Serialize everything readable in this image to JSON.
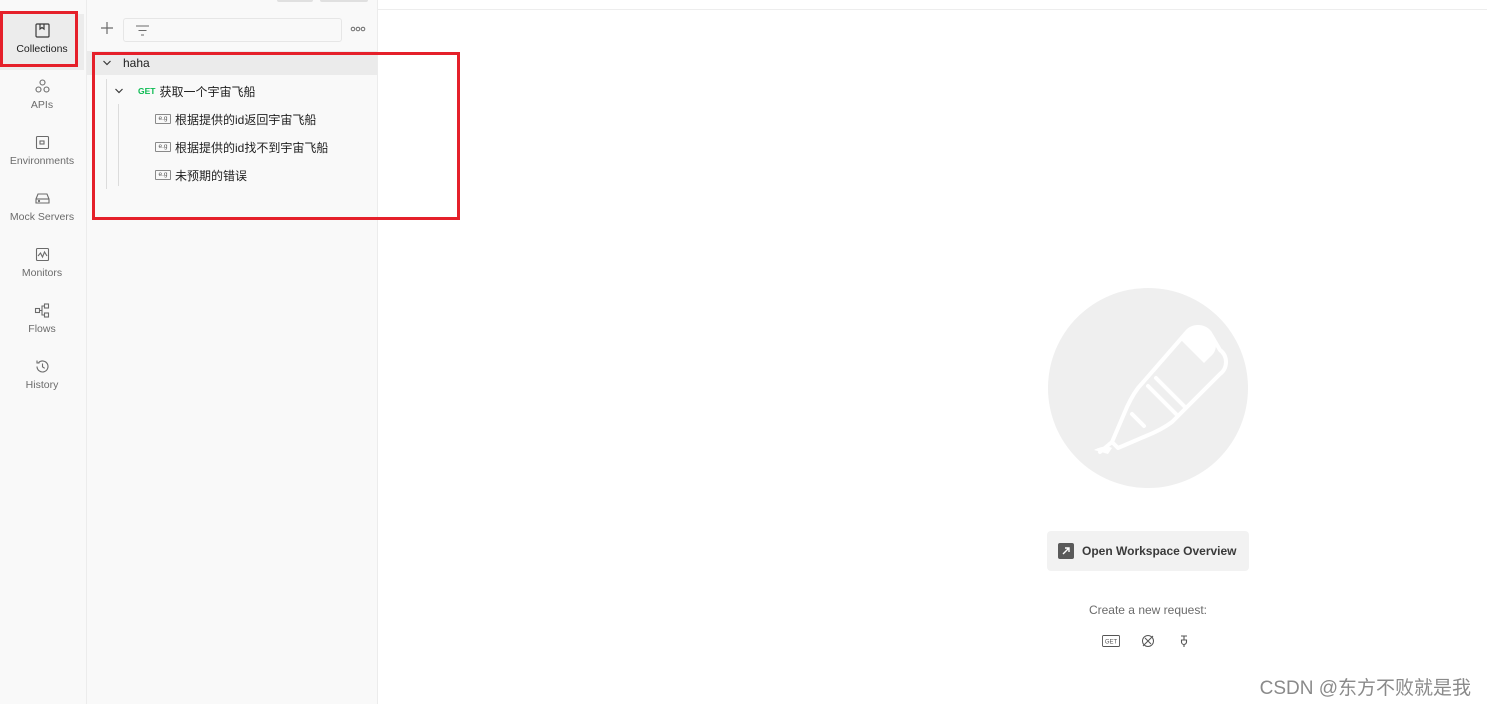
{
  "rail": {
    "items": [
      {
        "label": "Collections",
        "icon": "collections-icon",
        "active": true
      },
      {
        "label": "APIs",
        "icon": "apis-icon"
      },
      {
        "label": "Environments",
        "icon": "environments-icon"
      },
      {
        "label": "Mock Servers",
        "icon": "mock-servers-icon"
      },
      {
        "label": "Monitors",
        "icon": "monitors-icon"
      },
      {
        "label": "Flows",
        "icon": "flows-icon"
      },
      {
        "label": "History",
        "icon": "history-icon"
      }
    ]
  },
  "sidebar": {
    "tree": {
      "collection": "haha",
      "request": {
        "method": "GET",
        "name": "获取一个宇宙飞船"
      },
      "examples": [
        {
          "badge": "e.g",
          "name": "根据提供的id返回宇宙飞船"
        },
        {
          "badge": "e.g",
          "name": "根据提供的id找不到宇宙飞船"
        },
        {
          "badge": "e.g",
          "name": "未预期的错误"
        }
      ]
    }
  },
  "main": {
    "workspace_button": "Open Workspace Overview",
    "create_label": "Create a new request:",
    "request_icons": [
      "http-request-icon",
      "graphql-request-icon",
      "grpc-request-icon"
    ],
    "get_badge": "GET"
  },
  "watermark": "CSDN @东方不败就是我",
  "colors": {
    "get_method": "#0cbb52",
    "highlight": "#e5202a",
    "logo_bg": "#efefef"
  }
}
